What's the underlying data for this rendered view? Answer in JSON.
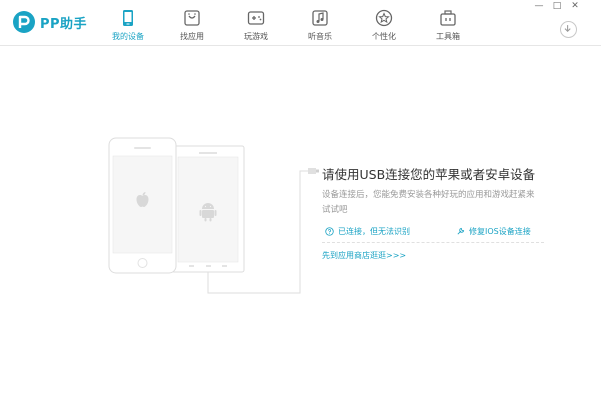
{
  "app": {
    "name": "PP助手",
    "accent": "#1aa3c4"
  },
  "nav": {
    "items": [
      {
        "label": "我的设备",
        "icon": "phone-icon",
        "active": true
      },
      {
        "label": "找应用",
        "icon": "app-box-icon",
        "active": false
      },
      {
        "label": "玩游戏",
        "icon": "gamepad-icon",
        "active": false
      },
      {
        "label": "听音乐",
        "icon": "music-note-icon",
        "active": false
      },
      {
        "label": "个性化",
        "icon": "star-icon",
        "active": false
      },
      {
        "label": "工具箱",
        "icon": "toolbox-icon",
        "active": false
      }
    ]
  },
  "window": {
    "minimize": "—",
    "maximize": "□",
    "close": "✕"
  },
  "message": {
    "title": "请使用USB连接您的苹果或者安卓设备",
    "desc": "设备连接后，您能免费安装各种好玩的应用和游戏赶紧来试试吧",
    "link_connected": "已连接，但无法识别",
    "link_repair": "修复IOS设备连接",
    "link_bottom": "先到应用商店逛逛>>>"
  }
}
